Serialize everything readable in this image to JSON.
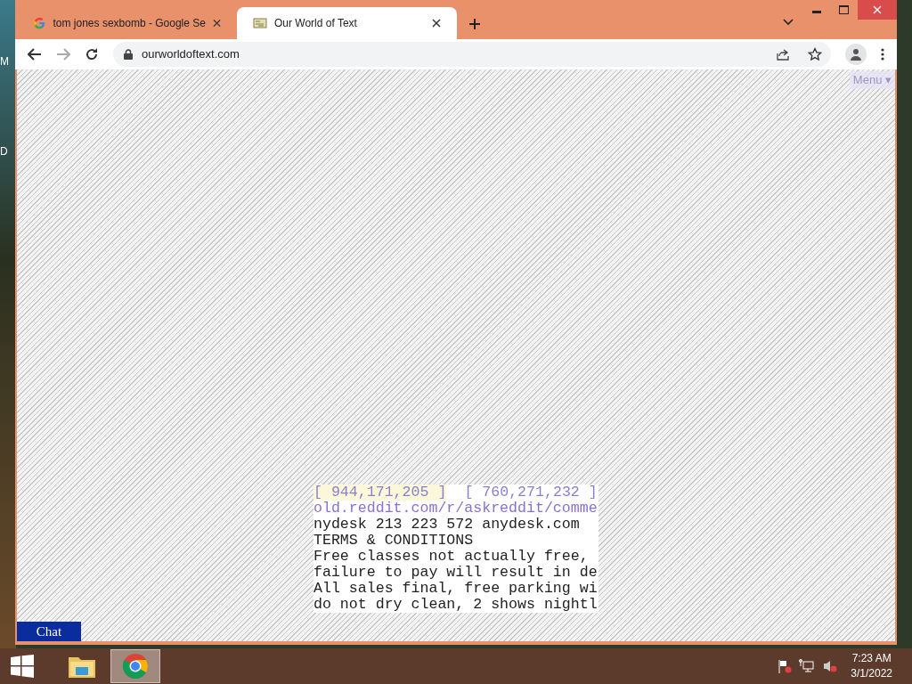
{
  "desktop_labels": [
    "M",
    "D"
  ],
  "tabs": [
    {
      "title": "tom jones sexbomb - Google Se",
      "kind": "google",
      "selected": false
    },
    {
      "title": "Our World of Text",
      "kind": "world",
      "selected": true
    }
  ],
  "address": "ourworldoftext.com",
  "page": {
    "menu_label": "Menu ▾",
    "coordinates": [
      "[ 944,171,205 ]",
      "[ 760,271,232 ]"
    ],
    "link": "old.reddit.com/r/askreddit/comme",
    "lines": [
      "nydesk 213 223 572 anydesk.com",
      "TERMS & CONDITIONS",
      "Free classes not actually free,",
      "failure to pay will result in de",
      "All sales final, free parking wi",
      "do not dry clean, 2 shows nightl"
    ],
    "chat_label": "Chat"
  },
  "taskbar": {
    "apps": [
      {
        "kind": "folder",
        "selected": false
      },
      {
        "kind": "chrome",
        "selected": true
      }
    ],
    "time": "7:23 AM",
    "date": "3/1/2022"
  }
}
